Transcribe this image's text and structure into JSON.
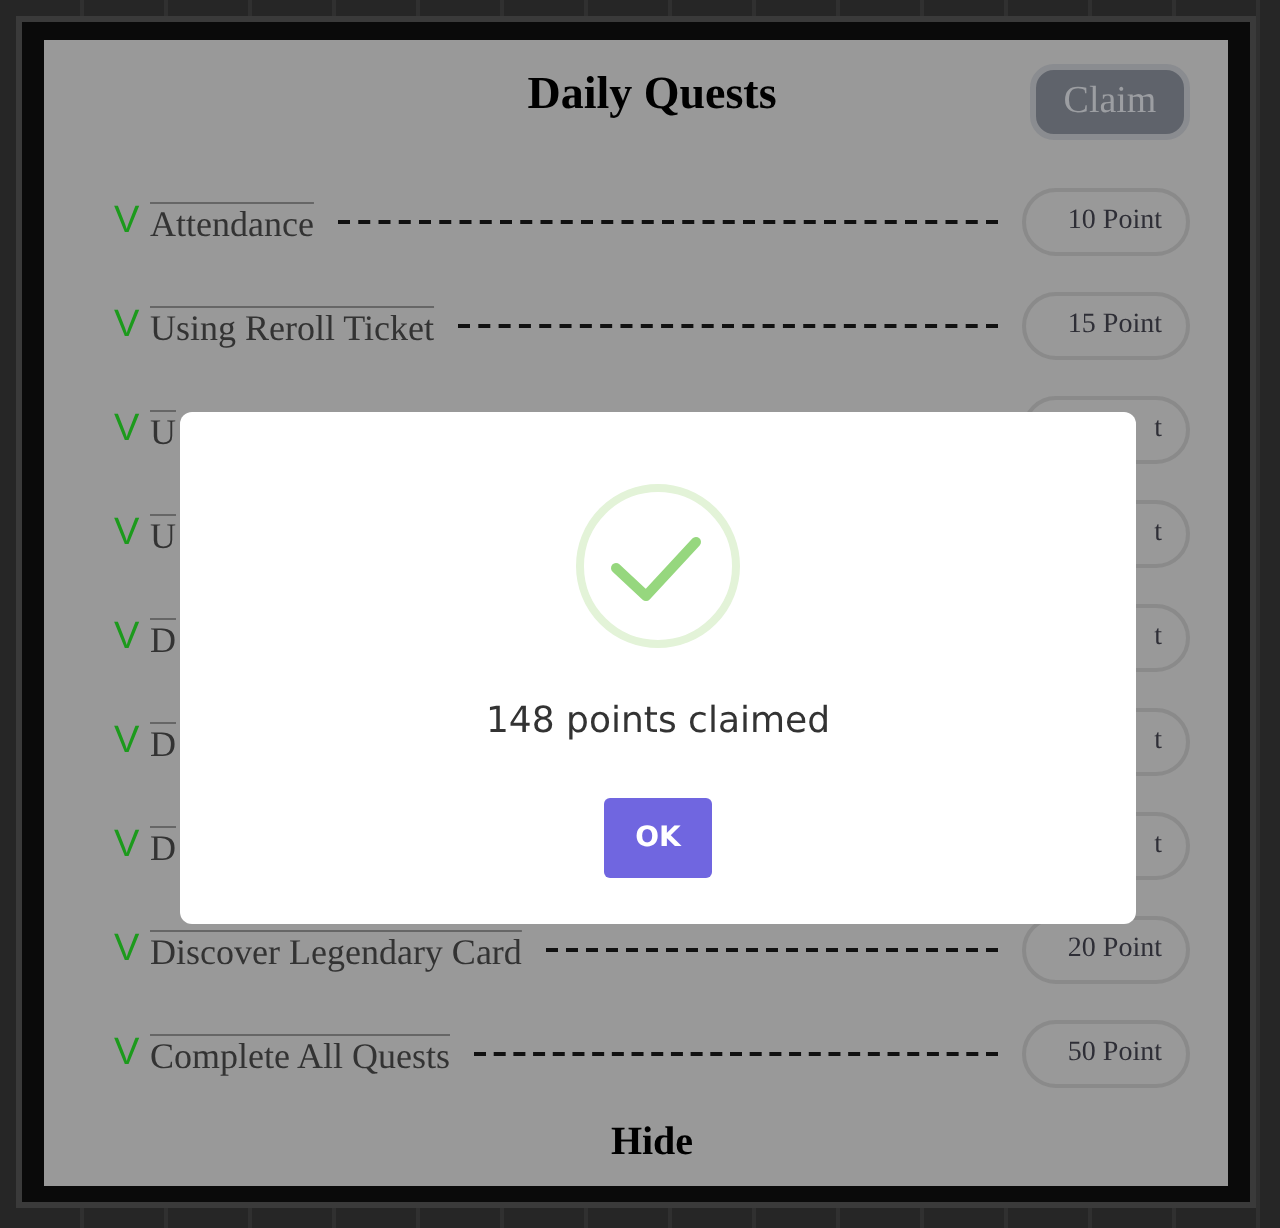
{
  "panel": {
    "title": "Daily Quests",
    "claim_button": "Claim",
    "hide_button": "Hide"
  },
  "quests": [
    {
      "mark": "V",
      "label": "Attendance",
      "points": "10 Point",
      "done": true
    },
    {
      "mark": "V",
      "label": "Using Reroll Ticket",
      "points": "15 Point",
      "done": true
    },
    {
      "mark": "V",
      "label": "U",
      "points": "t",
      "done": true
    },
    {
      "mark": "V",
      "label": "U",
      "points": "t",
      "done": true
    },
    {
      "mark": "V",
      "label": "D",
      "points": "t",
      "done": true
    },
    {
      "mark": "V",
      "label": "D",
      "points": "t",
      "done": true
    },
    {
      "mark": "V",
      "label": "D",
      "points": "t",
      "done": true
    },
    {
      "mark": "V",
      "label": "Discover Legendary Card",
      "points": "20 Point",
      "done": true
    },
    {
      "mark": "V",
      "label": "Complete All Quests",
      "points": "50 Point",
      "done": true
    }
  ],
  "dialog": {
    "message": "148 points claimed",
    "ok_button": "OK"
  }
}
